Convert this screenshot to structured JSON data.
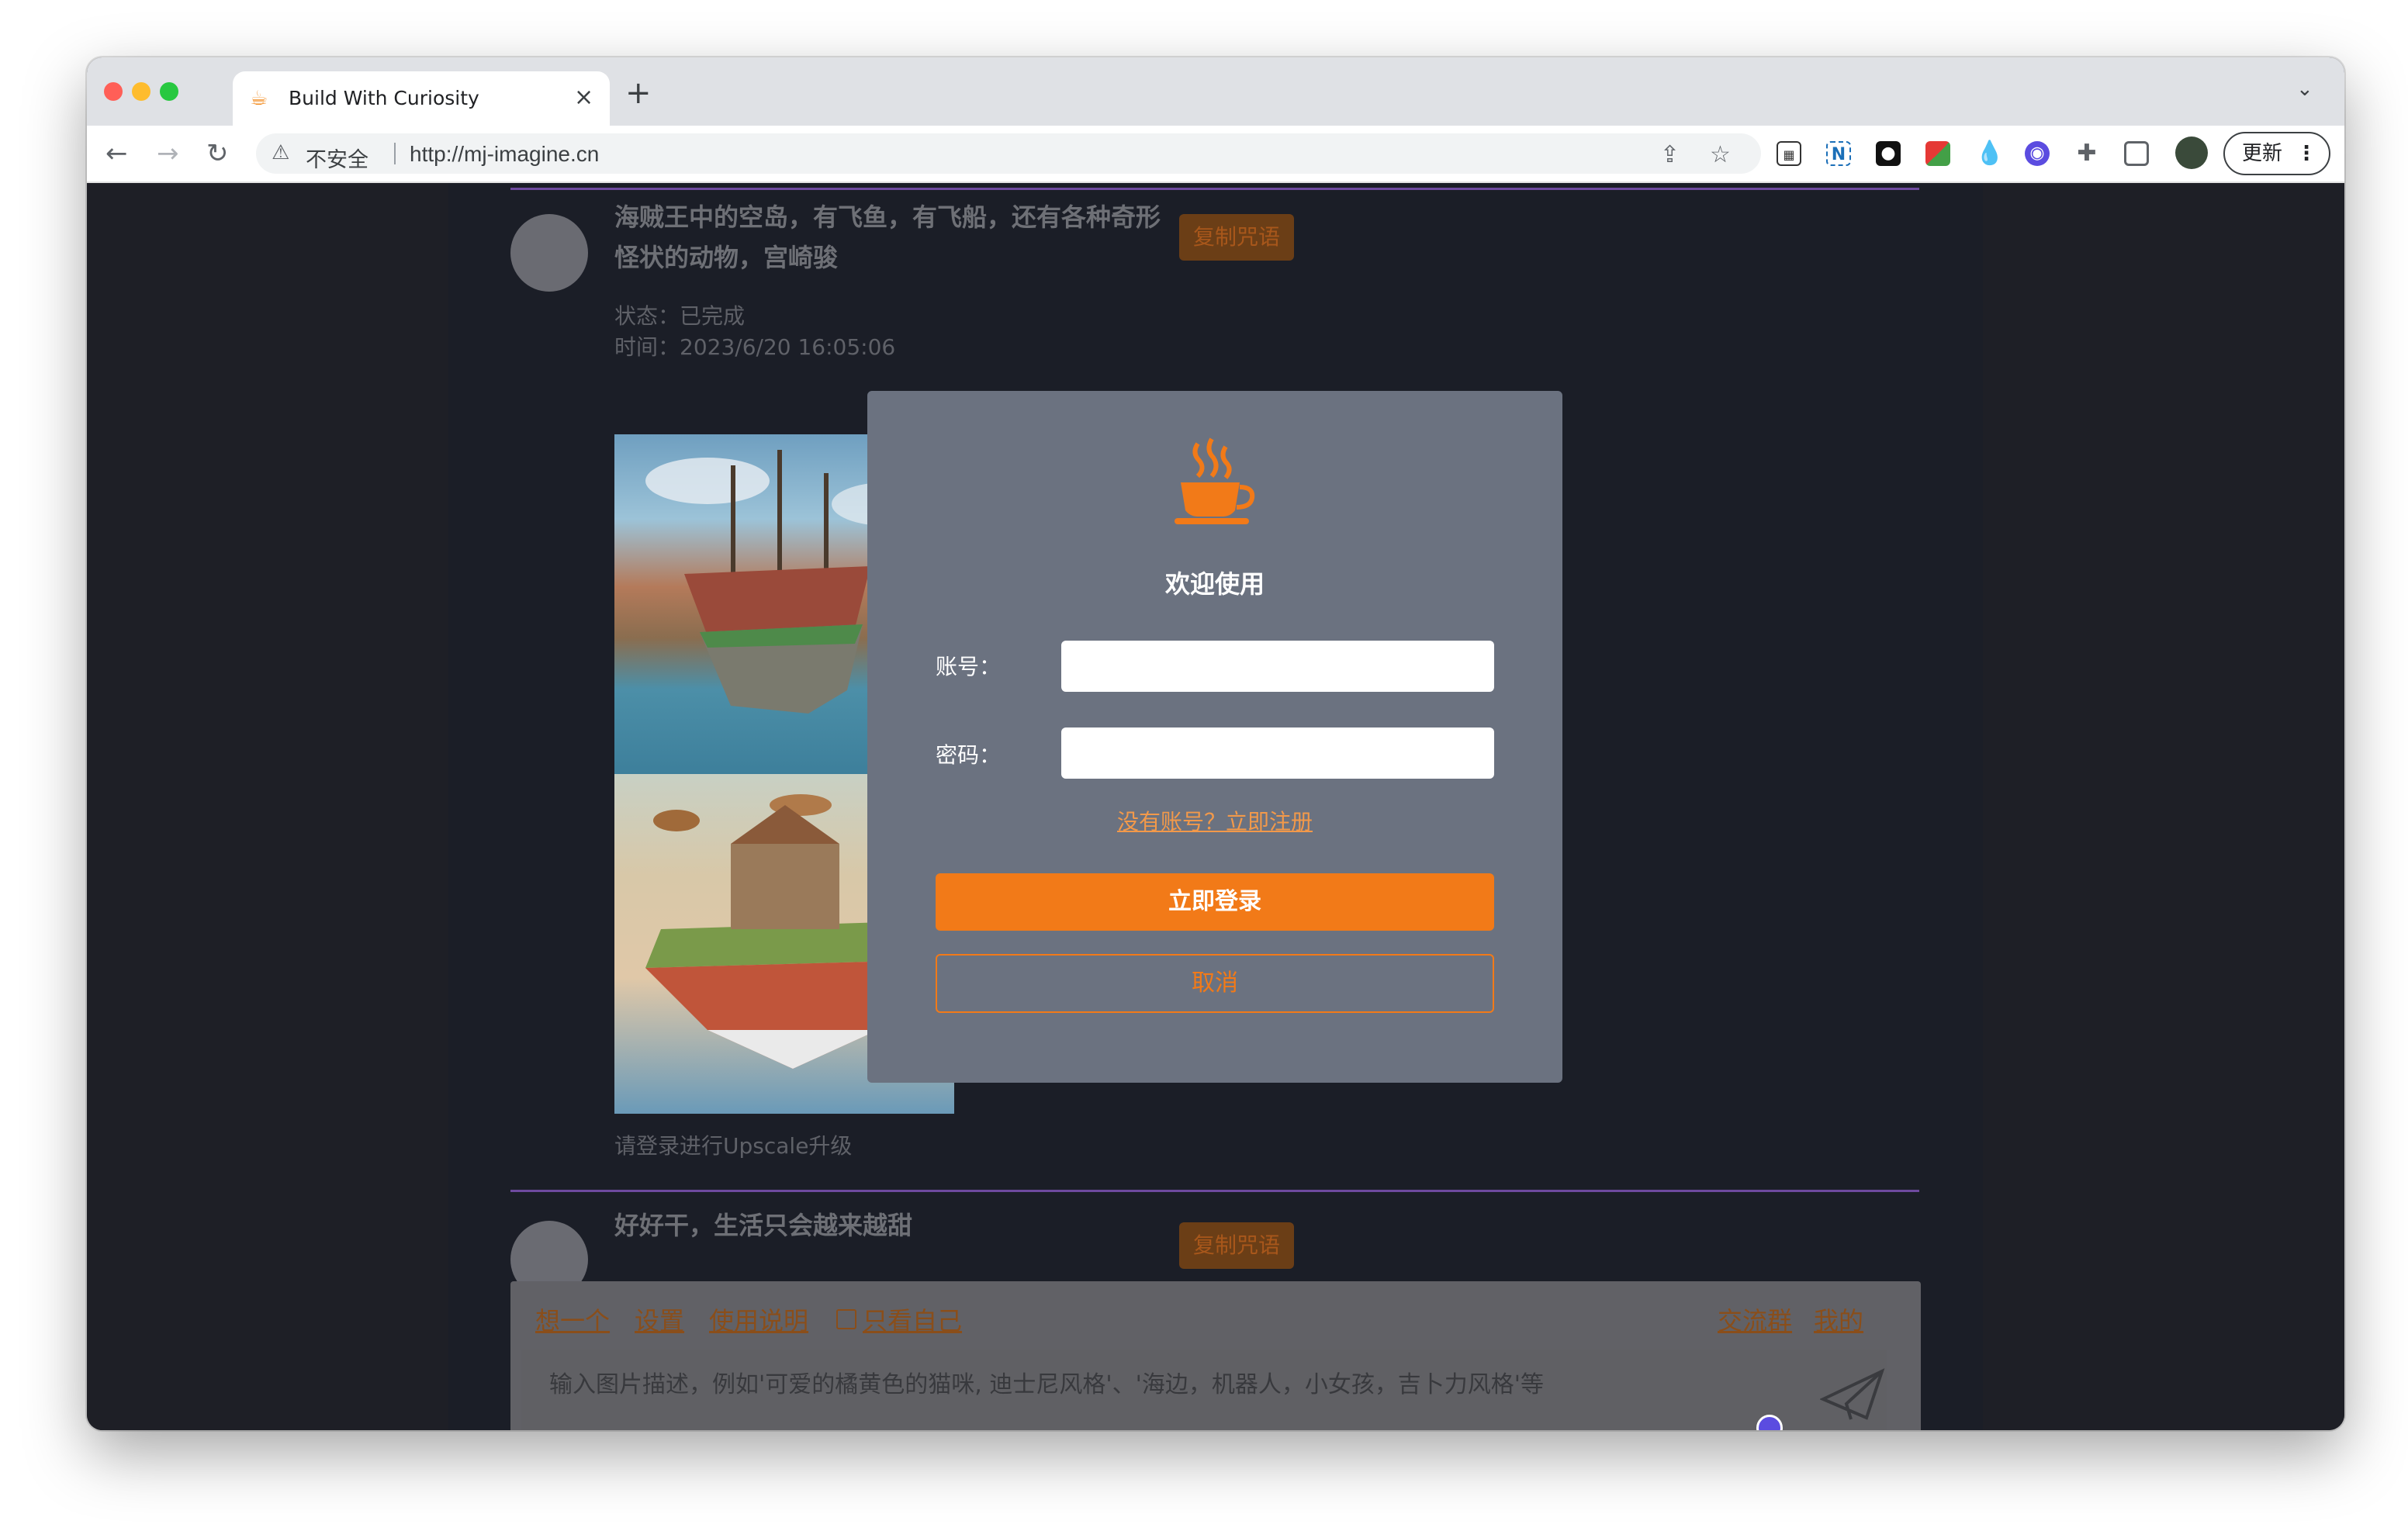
{
  "browser": {
    "tab_title": "Build With Curiosity",
    "new_tab": "+",
    "close_tab": "×",
    "insecure_label": "不安全",
    "url": "http://mj-imagine.cn",
    "update_label": "更新"
  },
  "feed": {
    "items": [
      {
        "prompt": "海贼王中的空岛，有飞鱼，有飞船，还有各种奇形怪状的动物，宫崎骏",
        "copy_label": "复制咒语",
        "status": "状态：已完成",
        "time": "时间：2023/6/20 16:05:06",
        "upscale_hint": "请登录进行Upscale升级"
      },
      {
        "prompt": "好好干，生活只会越来越甜",
        "copy_label": "复制咒语"
      }
    ]
  },
  "composer": {
    "links": [
      "想一个",
      "设置",
      "使用说明",
      "只看自己"
    ],
    "right_links": [
      "交流群",
      "我的"
    ],
    "placeholder": "输入图片描述，例如'可爱的橘黄色的猫咪, 迪士尼风格'、'海边，机器人，小女孩，吉卜力风格'等"
  },
  "login_modal": {
    "welcome": "欢迎使用",
    "account_label": "账号：",
    "password_label": "密码：",
    "register_link": "没有账号？立即注册",
    "login_button": "立即登录",
    "cancel_button": "取消"
  },
  "colors": {
    "accent": "#f27a18",
    "modal_bg": "#6b7280",
    "page_bg": "#1b1e27",
    "divider": "#6e4a9f"
  }
}
